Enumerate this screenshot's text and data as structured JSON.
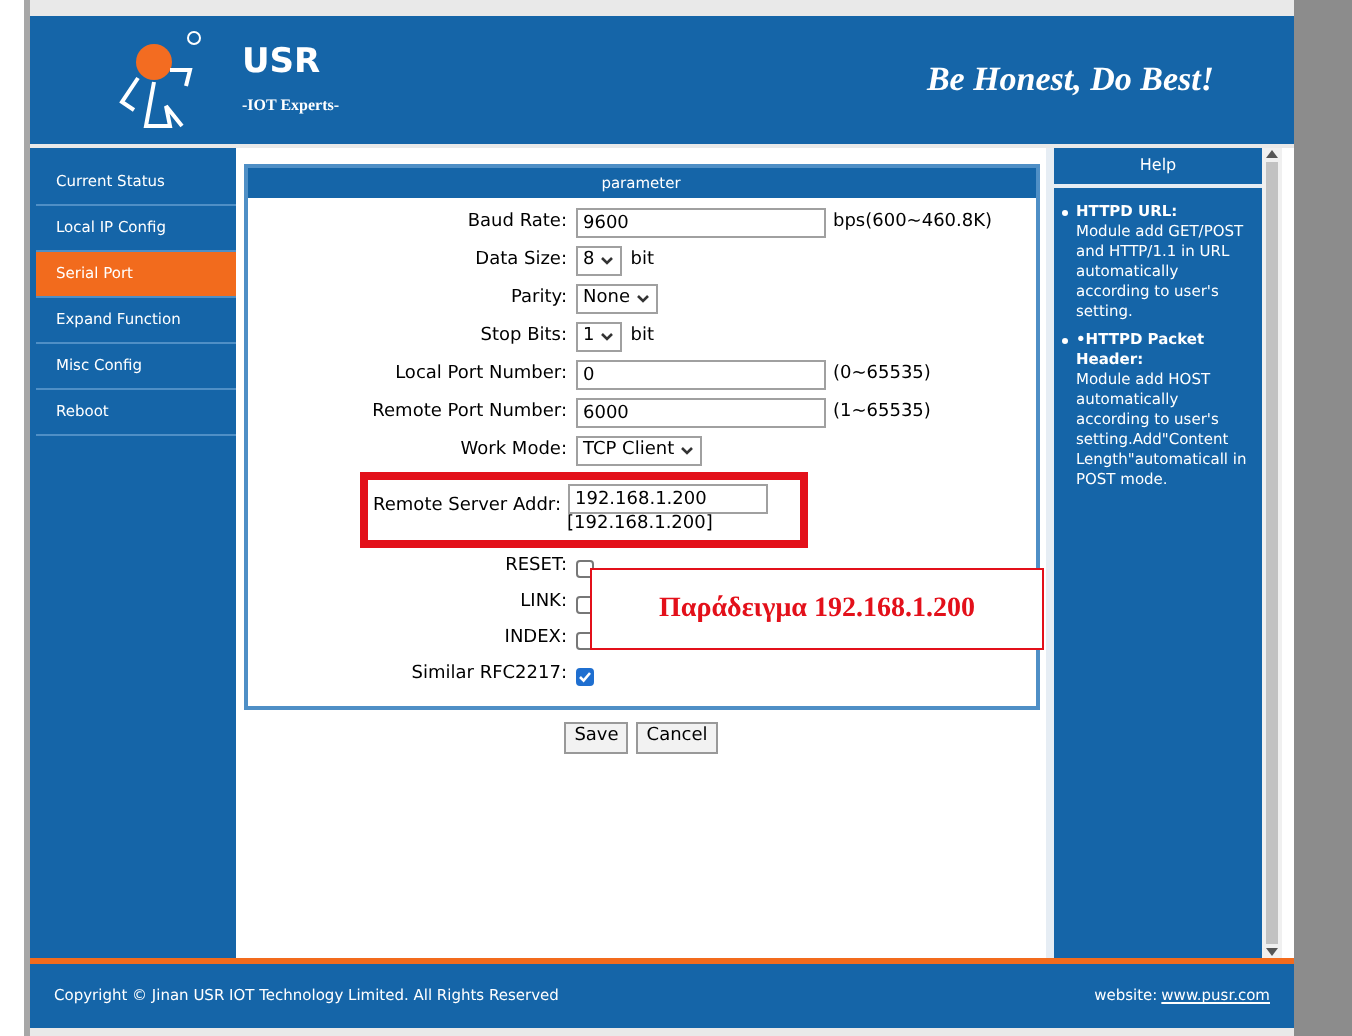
{
  "header": {
    "brand": "USR",
    "tagline": "-IOT Experts-",
    "slogan": "Be Honest, Do Best!"
  },
  "sidebar": {
    "items": [
      {
        "label": "Current Status",
        "selected": false
      },
      {
        "label": "Local IP Config",
        "selected": false
      },
      {
        "label": "Serial Port",
        "selected": true
      },
      {
        "label": "Expand Function",
        "selected": false
      },
      {
        "label": "Misc Config",
        "selected": false
      },
      {
        "label": "Reboot",
        "selected": false
      }
    ]
  },
  "panel": {
    "title": "parameter",
    "rows": [
      {
        "kind": "input",
        "label": "Baud Rate:",
        "value": "9600",
        "suffix": "bps(600~460.8K)",
        "highlighted": false
      },
      {
        "kind": "select",
        "label": "Data Size:",
        "value": "8",
        "suffix": "bit",
        "highlighted": false
      },
      {
        "kind": "select",
        "label": "Parity:",
        "value": "None",
        "highlighted": false
      },
      {
        "kind": "select",
        "label": "Stop Bits:",
        "value": "1",
        "suffix": "bit",
        "highlighted": false
      },
      {
        "kind": "input",
        "label": "Local Port Number:",
        "value": "0",
        "suffix": "(0~65535)",
        "highlighted": false
      },
      {
        "kind": "input",
        "label": "Remote Port Number:",
        "value": "6000",
        "suffix": "(1~65535)",
        "highlighted": false
      },
      {
        "kind": "select",
        "label": "Work Mode:",
        "value": "TCP Client",
        "highlighted": false
      },
      {
        "kind": "input",
        "label": "Remote Server Addr:",
        "value": "192.168.1.200",
        "note": "[192.168.1.200]",
        "highlighted": true
      },
      {
        "kind": "checkbox",
        "label": "RESET:",
        "checked": false
      },
      {
        "kind": "checkbox",
        "label": "LINK:",
        "checked": false
      },
      {
        "kind": "checkbox",
        "label": "INDEX:",
        "checked": false
      },
      {
        "kind": "checkbox",
        "label": "Similar RFC2217:",
        "checked": true
      }
    ]
  },
  "buttons": [
    "Save",
    "Cancel"
  ],
  "callout": "Παράδειγμα 192.168.1.200",
  "help": {
    "title": "Help",
    "items": [
      {
        "title": "HTTPD URL:",
        "text": "Module add GET/POST and HTTP/1.1 in URL automatically according to user's setting."
      },
      {
        "title": "•HTTPD Packet Header:",
        "text": "Module add HOST automatically according to user's setting.Add\"Content Length\"automaticall in POST mode."
      }
    ]
  },
  "footer": {
    "copyright": "Copyright © Jinan USR IOT Technology Limited. All Rights Reserved",
    "website_label": "website:",
    "website": "www.pusr.com"
  }
}
